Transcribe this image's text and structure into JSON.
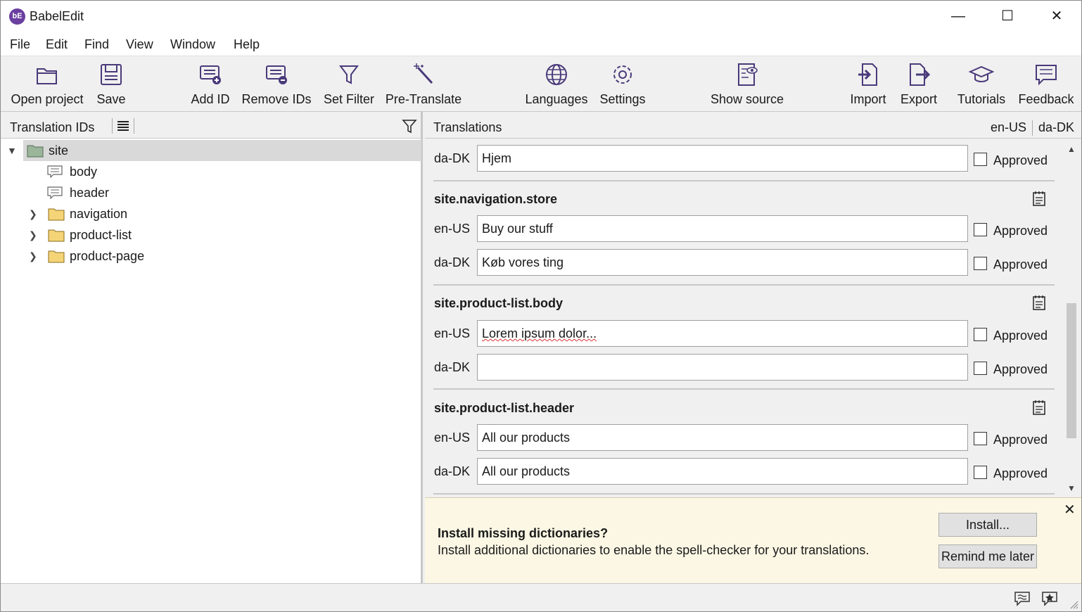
{
  "app": {
    "title": "BabelEdit",
    "logo_text": "bE"
  },
  "window_controls": {
    "minimize": "—",
    "maximize": "☐",
    "close": "✕"
  },
  "menu": [
    {
      "label": "File"
    },
    {
      "label": "Edit"
    },
    {
      "label": "Find"
    },
    {
      "label": "View"
    },
    {
      "label": "Window"
    },
    {
      "label": "Help"
    }
  ],
  "toolbar": {
    "open_project": "Open project",
    "save": "Save",
    "add_id": "Add ID",
    "remove_ids": "Remove IDs",
    "set_filter": "Set Filter",
    "pre_translate": "Pre-Translate",
    "languages": "Languages",
    "settings": "Settings",
    "show_source": "Show source",
    "import": "Import",
    "export": "Export",
    "tutorials": "Tutorials",
    "feedback": "Feedback"
  },
  "left_panel": {
    "title": "Translation IDs",
    "tree": {
      "root": "site",
      "body": "body",
      "header": "header",
      "navigation": "navigation",
      "product_list": "product-list",
      "product_page": "product-page"
    }
  },
  "right_panel": {
    "title": "Translations",
    "languages": [
      "en-US",
      "da-DK"
    ],
    "top_row": {
      "lang": "da-DK",
      "value": "Hjem",
      "approved_label": "Approved"
    },
    "entries": [
      {
        "key": "site.navigation.store",
        "rows": [
          {
            "lang": "en-US",
            "value": "Buy our stuff",
            "approved_label": "Approved"
          },
          {
            "lang": "da-DK",
            "value": "Køb vores ting",
            "approved_label": "Approved"
          }
        ]
      },
      {
        "key": "site.product-list.body",
        "rows": [
          {
            "lang": "en-US",
            "value": "Lorem ipsum dolor...",
            "approved_label": "Approved"
          },
          {
            "lang": "da-DK",
            "value": "",
            "approved_label": "Approved"
          }
        ]
      },
      {
        "key": "site.product-list.header",
        "rows": [
          {
            "lang": "en-US",
            "value": "All our products",
            "approved_label": "Approved"
          },
          {
            "lang": "da-DK",
            "value": "All our products",
            "approved_label": "Approved"
          }
        ]
      }
    ]
  },
  "notification": {
    "title": "Install missing dictionaries?",
    "text": "Install additional dictionaries to enable the spell-checker for your translations.",
    "install_label": "Install...",
    "remind_label": "Remind me later",
    "close": "✕"
  },
  "colors": {
    "accent": "#6a3fa0",
    "toolbar_icon": "#4a3a7a",
    "folder": "#f5d478",
    "notification_bg": "#fbf7e4"
  }
}
